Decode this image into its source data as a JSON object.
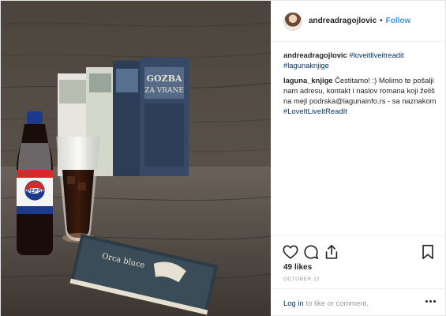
{
  "post": {
    "photo": {
      "bottle_label": "PEPSI",
      "front_book_title": "Orca bluce",
      "books_spine_colors": [
        "#e9e6df",
        "#d8dccf",
        "#2c3f5a",
        "#3a4f6e"
      ]
    },
    "header": {
      "username": "andreadragojlovic",
      "separator": "•",
      "follow_label": "Follow"
    },
    "caption": {
      "username": "andreadragojlovic",
      "hashtags": [
        "#loveitliveitreadit",
        "#lagunaknjige"
      ]
    },
    "reply": {
      "username": "laguna_knjige",
      "text": "Čestitamo! :) Molimo te pošalji nam adresu, kontakt i naslov romana koji želiš na mejl podrska@lagunainfo.rs - sa naznakom",
      "hashtag": "#LoveItLiveItReadIt"
    },
    "actions": {
      "like_icon": "heart-icon",
      "comment_icon": "comment-icon",
      "share_icon": "share-icon",
      "save_icon": "bookmark-icon"
    },
    "likes": "49 likes",
    "date": "OCTOBER 22",
    "footer": {
      "login_label": "Log in",
      "login_suffix": "to like or comment.",
      "more_icon": "more-options-icon"
    },
    "colors": {
      "link": "#003569",
      "follow": "#3897f0",
      "muted": "#999999"
    }
  }
}
